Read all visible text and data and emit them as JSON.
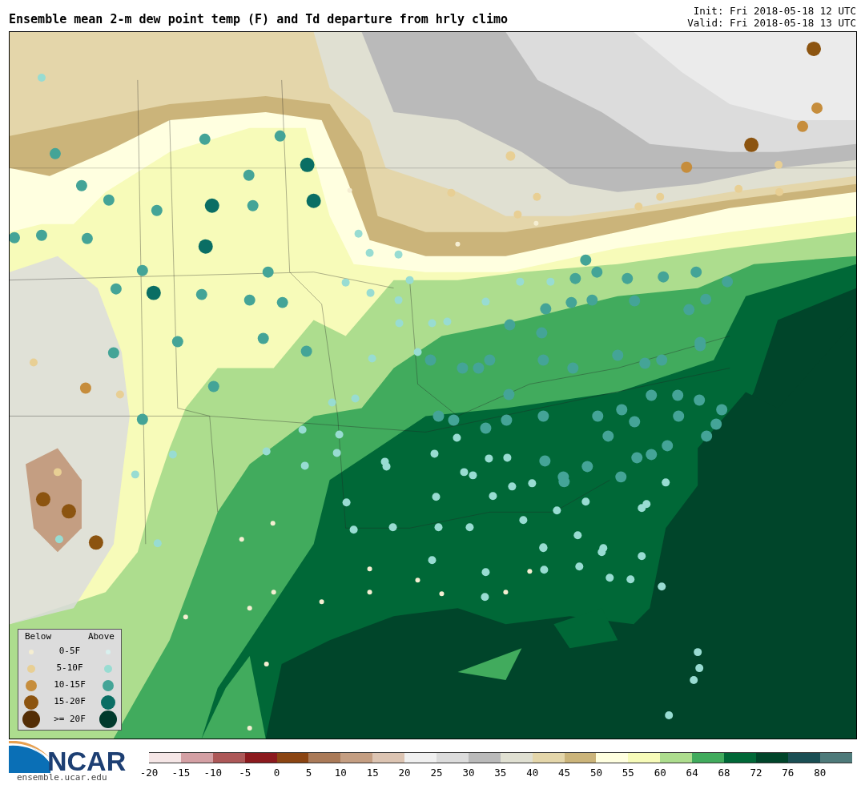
{
  "title": "Ensemble mean 2-m dew point temp (F) and Td departure from hrly climo",
  "init": "Init: Fri 2018-05-18 12 UTC",
  "valid": "Valid: Fri 2018-05-18 13 UTC",
  "legend": {
    "below_heading": "Below",
    "above_heading": "Above",
    "rows": [
      {
        "label": "0-5F",
        "below": {
          "color": "#f5eed2"
        },
        "above": {
          "color": "#d8f0ee"
        }
      },
      {
        "label": "5-10F",
        "below": {
          "color": "#e8cf94"
        },
        "above": {
          "color": "#98dcd2"
        }
      },
      {
        "label": "10-15F",
        "below": {
          "color": "#c68d3c"
        },
        "above": {
          "color": "#44a497"
        }
      },
      {
        "label": "15-20F",
        "below": {
          "color": "#8c5410"
        },
        "above": {
          "color": "#0a6e64"
        }
      },
      {
        "label": ">= 20F",
        "below": {
          "color": "#542e06"
        },
        "above": {
          "color": "#003a2c"
        }
      }
    ]
  },
  "colorbar": [
    {
      "label": "-20",
      "color": "#f5e6e6"
    },
    {
      "label": "-15",
      "color": "#d4a0a4"
    },
    {
      "label": "-10",
      "color": "#ad5858"
    },
    {
      "label": "-5",
      "color": "#8c1a1e"
    },
    {
      "label": "0",
      "color": "#8b4513"
    },
    {
      "label": "5",
      "color": "#aa7a58"
    },
    {
      "label": "10",
      "color": "#c49e82"
    },
    {
      "label": "15",
      "color": "#dcc4b2"
    },
    {
      "label": "20",
      "color": "#f0f0f0"
    },
    {
      "label": "25",
      "color": "#dcdcdc"
    },
    {
      "label": "30",
      "color": "#bababa"
    },
    {
      "label": "35",
      "color": "#e0e0d2"
    },
    {
      "label": "40",
      "color": "#e4d6aa"
    },
    {
      "label": "45",
      "color": "#cbb47a"
    },
    {
      "label": "50",
      "color": "#ffffe0"
    },
    {
      "label": "55",
      "color": "#f7fbb9"
    },
    {
      "label": "60",
      "color": "#addd8e"
    },
    {
      "label": "64",
      "color": "#41ab5d"
    },
    {
      "label": "68",
      "color": "#006837"
    },
    {
      "label": "72",
      "color": "#00452a"
    },
    {
      "label": "76",
      "color": "#1a4f54"
    },
    {
      "label": "80",
      "color": "#4e7a7a"
    }
  ],
  "logo": {
    "wordmark": "NCAR",
    "url": "ensemble.ucar.edu"
  }
}
